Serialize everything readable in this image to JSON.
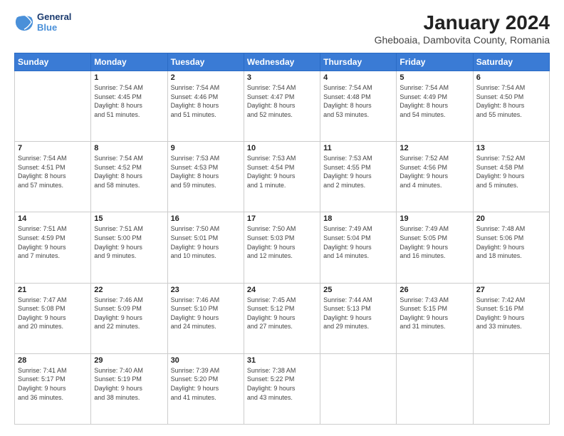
{
  "logo": {
    "line1": "General",
    "line2": "Blue"
  },
  "title": "January 2024",
  "location": "Gheboaia, Dambovita County, Romania",
  "weekdays": [
    "Sunday",
    "Monday",
    "Tuesday",
    "Wednesday",
    "Thursday",
    "Friday",
    "Saturday"
  ],
  "weeks": [
    [
      {
        "day": "",
        "info": ""
      },
      {
        "day": "1",
        "info": "Sunrise: 7:54 AM\nSunset: 4:45 PM\nDaylight: 8 hours\nand 51 minutes."
      },
      {
        "day": "2",
        "info": "Sunrise: 7:54 AM\nSunset: 4:46 PM\nDaylight: 8 hours\nand 51 minutes."
      },
      {
        "day": "3",
        "info": "Sunrise: 7:54 AM\nSunset: 4:47 PM\nDaylight: 8 hours\nand 52 minutes."
      },
      {
        "day": "4",
        "info": "Sunrise: 7:54 AM\nSunset: 4:48 PM\nDaylight: 8 hours\nand 53 minutes."
      },
      {
        "day": "5",
        "info": "Sunrise: 7:54 AM\nSunset: 4:49 PM\nDaylight: 8 hours\nand 54 minutes."
      },
      {
        "day": "6",
        "info": "Sunrise: 7:54 AM\nSunset: 4:50 PM\nDaylight: 8 hours\nand 55 minutes."
      }
    ],
    [
      {
        "day": "7",
        "info": "Sunrise: 7:54 AM\nSunset: 4:51 PM\nDaylight: 8 hours\nand 57 minutes."
      },
      {
        "day": "8",
        "info": "Sunrise: 7:54 AM\nSunset: 4:52 PM\nDaylight: 8 hours\nand 58 minutes."
      },
      {
        "day": "9",
        "info": "Sunrise: 7:53 AM\nSunset: 4:53 PM\nDaylight: 8 hours\nand 59 minutes."
      },
      {
        "day": "10",
        "info": "Sunrise: 7:53 AM\nSunset: 4:54 PM\nDaylight: 9 hours\nand 1 minute."
      },
      {
        "day": "11",
        "info": "Sunrise: 7:53 AM\nSunset: 4:55 PM\nDaylight: 9 hours\nand 2 minutes."
      },
      {
        "day": "12",
        "info": "Sunrise: 7:52 AM\nSunset: 4:56 PM\nDaylight: 9 hours\nand 4 minutes."
      },
      {
        "day": "13",
        "info": "Sunrise: 7:52 AM\nSunset: 4:58 PM\nDaylight: 9 hours\nand 5 minutes."
      }
    ],
    [
      {
        "day": "14",
        "info": "Sunrise: 7:51 AM\nSunset: 4:59 PM\nDaylight: 9 hours\nand 7 minutes."
      },
      {
        "day": "15",
        "info": "Sunrise: 7:51 AM\nSunset: 5:00 PM\nDaylight: 9 hours\nand 9 minutes."
      },
      {
        "day": "16",
        "info": "Sunrise: 7:50 AM\nSunset: 5:01 PM\nDaylight: 9 hours\nand 10 minutes."
      },
      {
        "day": "17",
        "info": "Sunrise: 7:50 AM\nSunset: 5:03 PM\nDaylight: 9 hours\nand 12 minutes."
      },
      {
        "day": "18",
        "info": "Sunrise: 7:49 AM\nSunset: 5:04 PM\nDaylight: 9 hours\nand 14 minutes."
      },
      {
        "day": "19",
        "info": "Sunrise: 7:49 AM\nSunset: 5:05 PM\nDaylight: 9 hours\nand 16 minutes."
      },
      {
        "day": "20",
        "info": "Sunrise: 7:48 AM\nSunset: 5:06 PM\nDaylight: 9 hours\nand 18 minutes."
      }
    ],
    [
      {
        "day": "21",
        "info": "Sunrise: 7:47 AM\nSunset: 5:08 PM\nDaylight: 9 hours\nand 20 minutes."
      },
      {
        "day": "22",
        "info": "Sunrise: 7:46 AM\nSunset: 5:09 PM\nDaylight: 9 hours\nand 22 minutes."
      },
      {
        "day": "23",
        "info": "Sunrise: 7:46 AM\nSunset: 5:10 PM\nDaylight: 9 hours\nand 24 minutes."
      },
      {
        "day": "24",
        "info": "Sunrise: 7:45 AM\nSunset: 5:12 PM\nDaylight: 9 hours\nand 27 minutes."
      },
      {
        "day": "25",
        "info": "Sunrise: 7:44 AM\nSunset: 5:13 PM\nDaylight: 9 hours\nand 29 minutes."
      },
      {
        "day": "26",
        "info": "Sunrise: 7:43 AM\nSunset: 5:15 PM\nDaylight: 9 hours\nand 31 minutes."
      },
      {
        "day": "27",
        "info": "Sunrise: 7:42 AM\nSunset: 5:16 PM\nDaylight: 9 hours\nand 33 minutes."
      }
    ],
    [
      {
        "day": "28",
        "info": "Sunrise: 7:41 AM\nSunset: 5:17 PM\nDaylight: 9 hours\nand 36 minutes."
      },
      {
        "day": "29",
        "info": "Sunrise: 7:40 AM\nSunset: 5:19 PM\nDaylight: 9 hours\nand 38 minutes."
      },
      {
        "day": "30",
        "info": "Sunrise: 7:39 AM\nSunset: 5:20 PM\nDaylight: 9 hours\nand 41 minutes."
      },
      {
        "day": "31",
        "info": "Sunrise: 7:38 AM\nSunset: 5:22 PM\nDaylight: 9 hours\nand 43 minutes."
      },
      {
        "day": "",
        "info": ""
      },
      {
        "day": "",
        "info": ""
      },
      {
        "day": "",
        "info": ""
      }
    ]
  ]
}
